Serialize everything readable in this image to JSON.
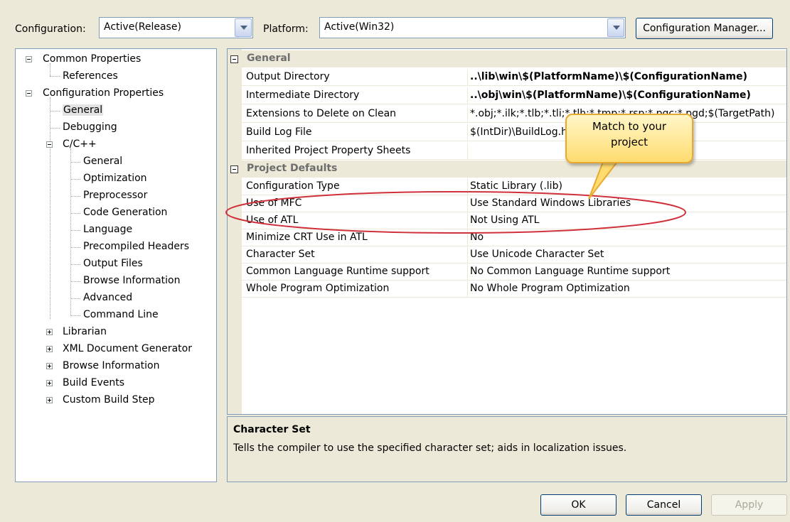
{
  "config": {
    "config_label": "Configuration:",
    "config_value": "Active(Release)",
    "platform_label": "Platform:",
    "platform_value": "Active(Win32)",
    "manager_button": "Configuration Manager..."
  },
  "tree": {
    "common_properties": "Common Properties",
    "references": "References",
    "configuration_properties": "Configuration Properties",
    "general": "General",
    "debugging": "Debugging",
    "cpp": "C/C++",
    "cpp_items": [
      "General",
      "Optimization",
      "Preprocessor",
      "Code Generation",
      "Language",
      "Precompiled Headers",
      "Output Files",
      "Browse Information",
      "Advanced",
      "Command Line"
    ],
    "librarian": "Librarian",
    "xml_doc": "XML Document Generator",
    "browse_info": "Browse Information",
    "build_events": "Build Events",
    "custom_build": "Custom Build Step"
  },
  "grid": {
    "cat_general": "General",
    "cat_defaults": "Project Defaults",
    "general_rows": [
      {
        "name": "Output Directory",
        "value": "..\\lib\\win\\$(PlatformName)\\$(ConfigurationName)"
      },
      {
        "name": "Intermediate Directory",
        "value": "..\\obj\\win\\$(PlatformName)\\$(ConfigurationName)"
      },
      {
        "name": "Extensions to Delete on Clean",
        "value": "*.obj;*.ilk;*.tlb;*.tli;*.tlh;*.tmp;*.rsp;*.pgc;*.pgd;$(TargetPath)"
      },
      {
        "name": "Build Log File",
        "value": "$(IntDir)\\BuildLog.htm"
      },
      {
        "name": "Inherited Project Property Sheets",
        "value": ""
      }
    ],
    "default_rows": [
      {
        "name": "Configuration Type",
        "value": "Static Library (.lib)"
      },
      {
        "name": "Use of MFC",
        "value": "Use Standard Windows Libraries"
      },
      {
        "name": "Use of ATL",
        "value": "Not Using ATL"
      },
      {
        "name": "Minimize CRT Use in ATL",
        "value": "No"
      },
      {
        "name": "Character Set",
        "value": "Use Unicode Character Set"
      },
      {
        "name": "Common Language Runtime support",
        "value": "No Common Language Runtime support"
      },
      {
        "name": "Whole Program Optimization",
        "value": "No Whole Program Optimization"
      }
    ]
  },
  "description": {
    "title": "Character Set",
    "text": "Tells the compiler to use the specified character set; aids in localization issues."
  },
  "callout": {
    "line1": "Match to your",
    "line2": "project"
  },
  "buttons": {
    "ok": "OK",
    "cancel": "Cancel",
    "apply": "Apply"
  },
  "colors": {
    "dialog_bg": "#ece9d8",
    "border": "#7f9db9",
    "highlight_oval": "#d0303a",
    "callout_fill": "#ffdc70"
  }
}
